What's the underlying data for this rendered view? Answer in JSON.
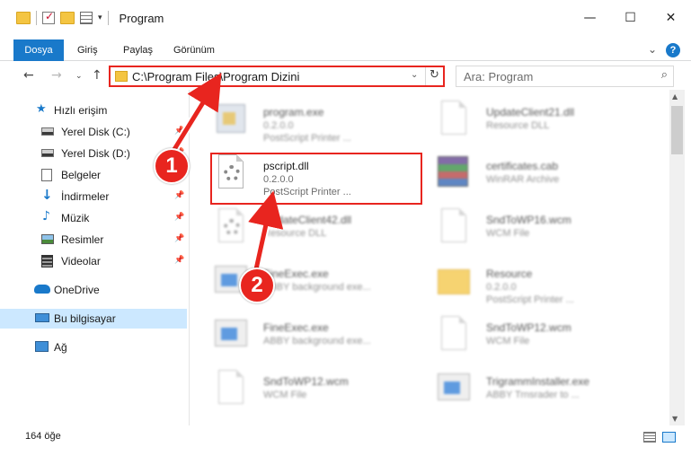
{
  "window": {
    "title": "Program",
    "controls": {
      "minimize": "—",
      "maximize": "☐",
      "close": "✕"
    }
  },
  "ribbon": {
    "tabs": [
      "Dosya",
      "Giriş",
      "Paylaş",
      "Görünüm"
    ],
    "active_tab": "Dosya",
    "expand_icon": "⌄",
    "help_icon": "?"
  },
  "nav": {
    "back_icon": "←",
    "forward_icon": "→",
    "recent_icon": "⌄",
    "up_icon": "↑",
    "address": "C:\\Program Files\\Program Dizini",
    "address_dropdown_icon": "⌄",
    "refresh_icon": "↻",
    "search_placeholder": "Ara: Program",
    "search_icon": "⌕"
  },
  "sidebar": {
    "items": [
      {
        "label": "Hızlı erişim",
        "icon": "star-icon",
        "pinned": false
      },
      {
        "label": "Yerel Disk (C:)",
        "icon": "drive-icon",
        "pinned": true
      },
      {
        "label": "Yerel Disk (D:)",
        "icon": "drive-icon",
        "pinned": true
      },
      {
        "label": "Belgeler",
        "icon": "documents-icon",
        "pinned": true
      },
      {
        "label": "İndirmeler",
        "icon": "download-icon",
        "pinned": true
      },
      {
        "label": "Müzik",
        "icon": "music-icon",
        "pinned": true
      },
      {
        "label": "Resimler",
        "icon": "pictures-icon",
        "pinned": true
      },
      {
        "label": "Videolar",
        "icon": "videos-icon",
        "pinned": true
      },
      {
        "label": "OneDrive",
        "icon": "cloud-icon",
        "pinned": false
      },
      {
        "label": "Bu bilgisayar",
        "icon": "computer-icon",
        "pinned": false,
        "selected": true
      },
      {
        "label": "Ağ",
        "icon": "network-icon",
        "pinned": false
      }
    ],
    "pin_glyph": "📌"
  },
  "files": [
    {
      "name": "program.exe",
      "sub1": "0.2.0.0",
      "sub2": "PostScript Printer ...",
      "icon": "exe-icon",
      "blurred": true
    },
    {
      "name": "UpdateClient21.dll",
      "sub1": "Resource DLL",
      "sub2": "",
      "icon": "dll-icon",
      "blurred": true
    },
    {
      "name": "pscript.dll",
      "sub1": "0.2.0.0",
      "sub2": "PostScript Printer ...",
      "icon": "gear-dll-icon",
      "blurred": false,
      "highlighted": true
    },
    {
      "name": "certificates.cab",
      "sub1": "WinRAR Archive",
      "sub2": "",
      "icon": "archive-icon",
      "blurred": true
    },
    {
      "name": "UpdateClient42.dll",
      "sub1": "Resource DLL",
      "sub2": "",
      "icon": "dll-icon",
      "blurred": true
    },
    {
      "name": "SndToWP16.wcm",
      "sub1": "WCM File",
      "sub2": "",
      "icon": "document-icon",
      "blurred": true
    },
    {
      "name": "FineExec.exe",
      "sub1": "ABBY background exe...",
      "sub2": "",
      "icon": "window-icon",
      "blurred": true
    },
    {
      "name": "Resource",
      "sub1": "0.2.0.0",
      "sub2": "PostScript Printer ...",
      "icon": "folder-icon",
      "blurred": true
    },
    {
      "name": "FineExec.exe",
      "sub1": "ABBY background exe...",
      "sub2": "",
      "icon": "window-icon",
      "blurred": true
    },
    {
      "name": "SndToWP12.wcm",
      "sub1": "WCM File",
      "sub2": "",
      "icon": "document-icon",
      "blurred": true
    },
    {
      "name": "SndToWP12.wcm",
      "sub1": "WCM File",
      "sub2": "",
      "icon": "document-icon",
      "blurred": true
    },
    {
      "name": "TrigrammInstaller.exe",
      "sub1": "ABBY Trnsrader to ...",
      "sub2": "",
      "icon": "window-icon",
      "blurred": true
    }
  ],
  "status": {
    "count": "164 öğe"
  },
  "annotations": {
    "marker_1": "1",
    "marker_2": "2",
    "accent_color": "#e8251f"
  },
  "colors": {
    "ribbon_file_tab": "#1979ca",
    "selection": "#cce8ff"
  }
}
